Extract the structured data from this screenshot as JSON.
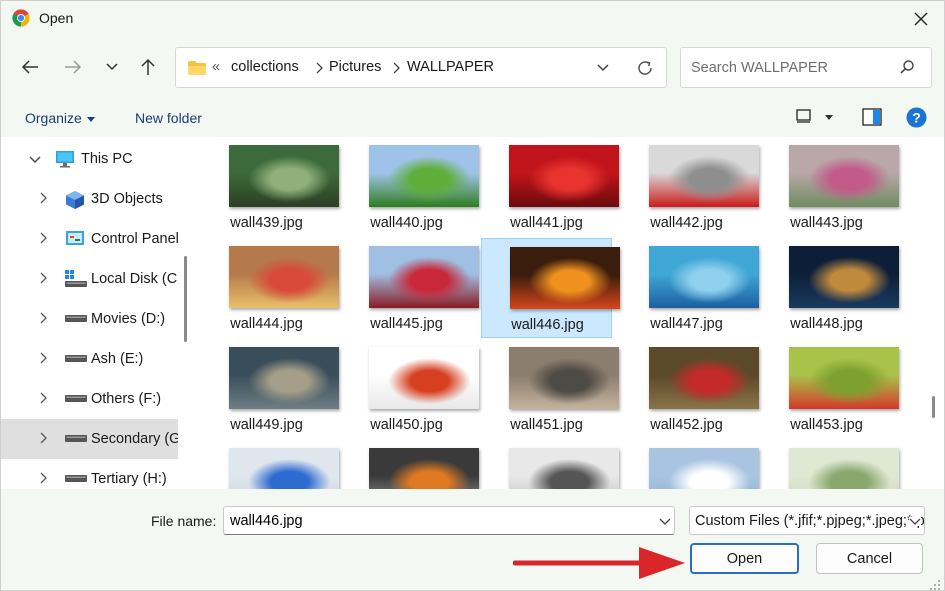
{
  "window": {
    "title": "Open",
    "close_glyph": "✕"
  },
  "nav": {
    "back_icon": "arrow-left-icon",
    "forward_icon": "arrow-right-icon",
    "recent_icon": "chevron-down-icon",
    "up_icon": "arrow-up-icon"
  },
  "address": {
    "overflow": "«",
    "segments": [
      "collections",
      "Pictures",
      "WALLPAPER"
    ]
  },
  "search": {
    "placeholder": "Search WALLPAPER"
  },
  "toolbar": {
    "organize_label": "Organize",
    "new_folder_label": "New folder"
  },
  "sidebar": {
    "items": [
      {
        "label": "This PC",
        "icon": "monitor-icon",
        "expanded": true
      },
      {
        "label": "3D Objects",
        "icon": "cube-icon"
      },
      {
        "label": "Control Panel",
        "icon": "control-panel-icon"
      },
      {
        "label": "Local Disk (C:)",
        "icon": "windows-drive-icon"
      },
      {
        "label": "Movies (D:)",
        "icon": "drive-icon"
      },
      {
        "label": "Ash (E:)",
        "icon": "drive-icon"
      },
      {
        "label": "Others (F:)",
        "icon": "drive-icon"
      },
      {
        "label": "Secondary (G:)",
        "icon": "drive-icon",
        "selected": true
      },
      {
        "label": "Tertiary (H:)",
        "icon": "drive-icon"
      }
    ]
  },
  "files": [
    {
      "name": "wall439.jpg",
      "colors": [
        "#3d6a3a",
        "#8fb07a",
        "#2c3e24"
      ]
    },
    {
      "name": "wall440.jpg",
      "colors": [
        "#9fc3e8",
        "#5fae3a",
        "#2e7d1f"
      ]
    },
    {
      "name": "wall441.jpg",
      "colors": [
        "#c0141a",
        "#e8332f",
        "#6b0b0d"
      ]
    },
    {
      "name": "wall442.jpg",
      "colors": [
        "#d9d9d9",
        "#8e8e8e",
        "#cc1a1a"
      ]
    },
    {
      "name": "wall443.jpg",
      "colors": [
        "#b9a7a9",
        "#c25a8a",
        "#6f8c5e"
      ]
    },
    {
      "name": "wall444.jpg",
      "colors": [
        "#b57a4b",
        "#d94a3a",
        "#e8c06a"
      ]
    },
    {
      "name": "wall445.jpg",
      "colors": [
        "#9fbfe3",
        "#c9283a",
        "#8a1b24"
      ]
    },
    {
      "name": "wall446.jpg",
      "colors": [
        "#3a1d0c",
        "#f0901f",
        "#d6461b"
      ],
      "selected": true
    },
    {
      "name": "wall447.jpg",
      "colors": [
        "#3fa7d6",
        "#8fd0ee",
        "#1d5fa0"
      ]
    },
    {
      "name": "wall448.jpg",
      "colors": [
        "#0d1f38",
        "#c08a3d",
        "#1a3a5e"
      ]
    },
    {
      "name": "wall449.jpg",
      "colors": [
        "#3a4d5a",
        "#a59f8a",
        "#6d7f84"
      ]
    },
    {
      "name": "wall450.jpg",
      "colors": [
        "#ffffff",
        "#d64020",
        "#e8e8e8"
      ]
    },
    {
      "name": "wall451.jpg",
      "colors": [
        "#8b7e6e",
        "#4e4a44",
        "#c2b39c"
      ]
    },
    {
      "name": "wall452.jpg",
      "colors": [
        "#5a4a2a",
        "#c42a2a",
        "#8a7448"
      ]
    },
    {
      "name": "wall453.jpg",
      "colors": [
        "#a8c24a",
        "#7da02f",
        "#d43a2a"
      ]
    },
    {
      "name": "",
      "colors": [
        "#dfe6ee",
        "#2e6bd1",
        "#c9d6e3"
      ]
    },
    {
      "name": "",
      "colors": [
        "#3a3a3a",
        "#e07a22",
        "#9a9a9a"
      ]
    },
    {
      "name": "",
      "colors": [
        "#e8e8e8",
        "#555555",
        "#bdbdbd"
      ]
    },
    {
      "name": "",
      "colors": [
        "#a9c4e0",
        "#ffffff",
        "#8aaed0"
      ]
    },
    {
      "name": "",
      "colors": [
        "#dfe8d2",
        "#8aa86e",
        "#c9d6b8"
      ]
    }
  ],
  "footer": {
    "file_name_label": "File name:",
    "file_name_value": "wall446.jpg",
    "file_type_value": "Custom Files (*.jfif;*.pjpeg;*.jpeg;*.pjp;*.jpg;*.png)",
    "open_label": "Open",
    "cancel_label": "Cancel"
  },
  "accent": "#2b6cc4",
  "annotation_arrow_color": "#d9262b"
}
